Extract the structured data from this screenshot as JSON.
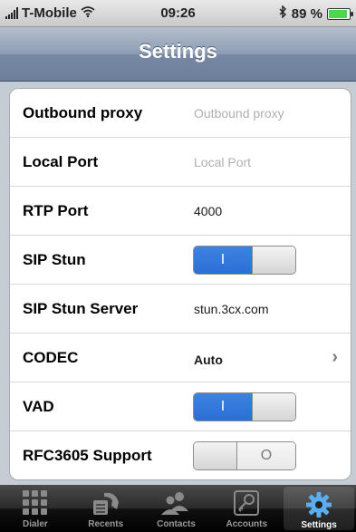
{
  "status_bar": {
    "carrier": "T-Mobile",
    "time": "09:26",
    "battery": "89 %",
    "battery_level": 0.89
  },
  "nav": {
    "title": "Settings"
  },
  "settings": {
    "outbound_proxy": {
      "label": "Outbound proxy",
      "value": "",
      "placeholder": "Outbound proxy"
    },
    "local_port": {
      "label": "Local Port",
      "value": "",
      "placeholder": "Local Port"
    },
    "rtp_port": {
      "label": "RTP Port",
      "value": "4000"
    },
    "sip_stun": {
      "label": "SIP Stun",
      "state": "on",
      "symbol": "I"
    },
    "sip_stun_server": {
      "label": "SIP Stun Server",
      "value": "stun.3cx.com"
    },
    "codec": {
      "label": "CODEC",
      "value": "Auto"
    },
    "vad": {
      "label": "VAD",
      "state": "on",
      "symbol": "I"
    },
    "rfc3605": {
      "label": "RFC3605 Support",
      "state": "off",
      "symbol": "O"
    }
  },
  "tabs": [
    {
      "label": "Dialer",
      "icon": "keypad-icon",
      "active": false
    },
    {
      "label": "Recents",
      "icon": "phone-icon",
      "active": false
    },
    {
      "label": "Contacts",
      "icon": "contacts-icon",
      "active": false
    },
    {
      "label": "Accounts",
      "icon": "key-icon",
      "active": false
    },
    {
      "label": "Settings",
      "icon": "gear-icon",
      "active": true
    }
  ],
  "colors": {
    "toggle_on": "#2b6ed6",
    "nav_bar": "#7688a2",
    "background": "#c5ccd4"
  }
}
